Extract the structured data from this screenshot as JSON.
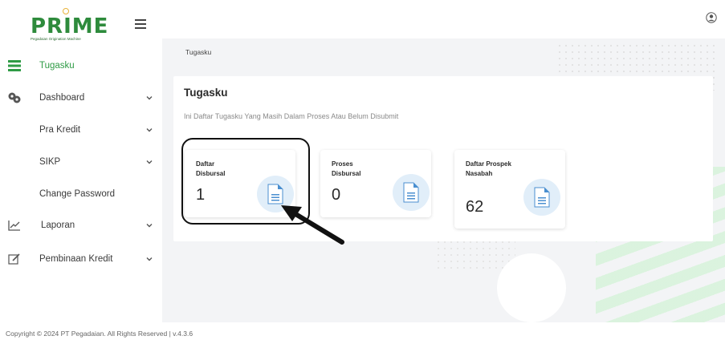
{
  "brand": {
    "name": "PRIME",
    "subtitle": "Pegadaian Origination Machine",
    "color": "#2e8b3c"
  },
  "sidebar": {
    "items": [
      {
        "label": "Tugasku",
        "icon": "list-icon",
        "has_chevron": false,
        "active": true
      },
      {
        "label": "Dashboard",
        "icon": "dashboard-icon",
        "has_chevron": true,
        "active": false
      },
      {
        "label": "Pra Kredit",
        "icon": "",
        "has_chevron": true,
        "active": false
      },
      {
        "label": "SIKP",
        "icon": "",
        "has_chevron": true,
        "active": false
      },
      {
        "label": "Change Password",
        "icon": "",
        "has_chevron": false,
        "active": false
      },
      {
        "label": "Laporan",
        "icon": "chart-line-icon",
        "has_chevron": true,
        "active": false
      },
      {
        "label": "Pembinaan Kredit",
        "icon": "edit-icon",
        "has_chevron": true,
        "active": false
      }
    ]
  },
  "breadcrumb": "Tugasku",
  "panel": {
    "title": "Tugasku",
    "description": "Ini Daftar Tugasku Yang Masih Dalam Proses Atau Belum Disubmit",
    "cards": [
      {
        "title": "Daftar Disbursal",
        "count": "1",
        "icon": "document-icon"
      },
      {
        "title": "Proses Disbursal",
        "count": "0",
        "icon": "document-icon"
      },
      {
        "title": "Daftar Prospek Nasabah",
        "count": "62",
        "icon": "document-icon"
      }
    ]
  },
  "footer": {
    "text": "Copyright © 2024 PT Pegadaian. All Rights Reserved | v.4.3.6"
  },
  "colors": {
    "accent": "#2e9b45",
    "icon_bg": "#e1eef9",
    "icon_fg": "#4a8fd0"
  }
}
